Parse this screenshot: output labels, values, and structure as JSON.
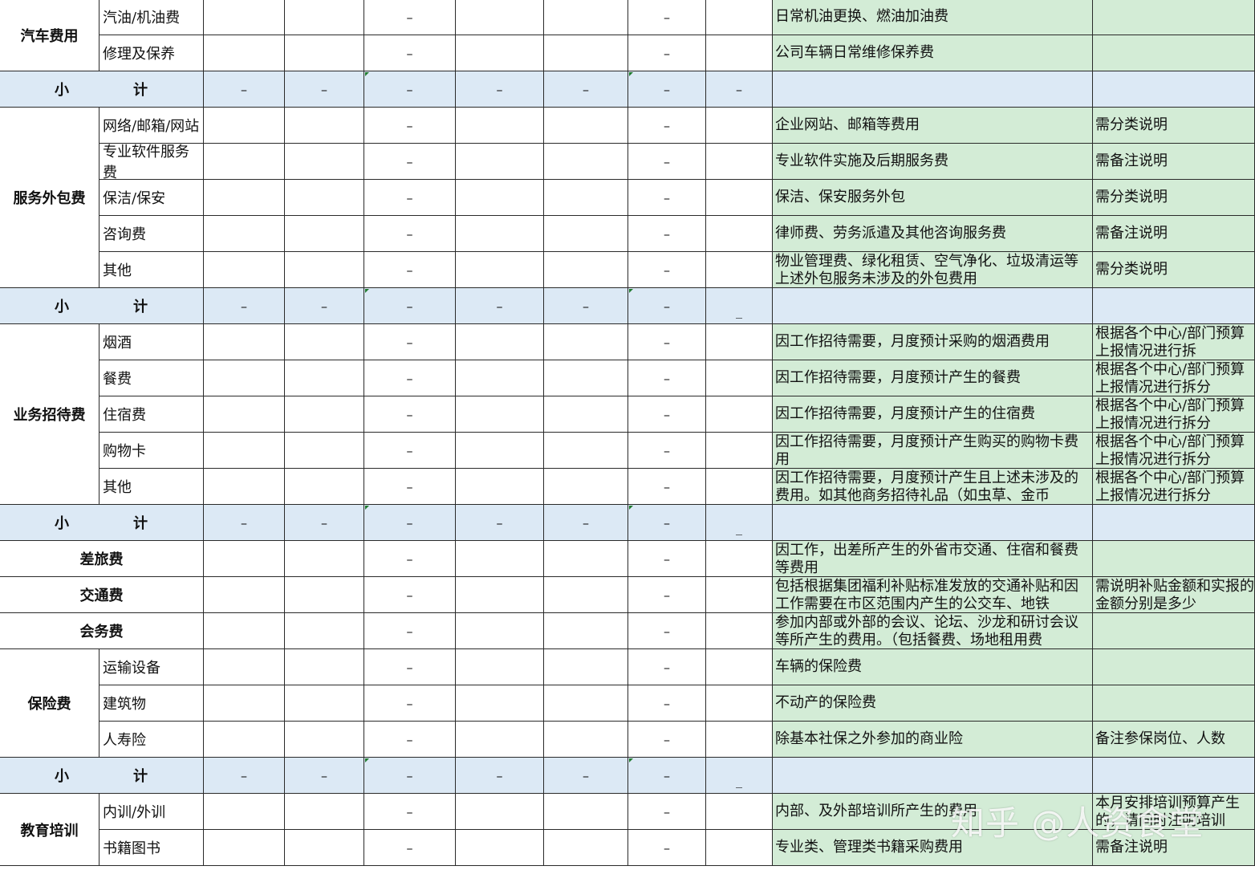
{
  "dash": "–",
  "underscore": "_",
  "subtotal_label": [
    "小",
    "计"
  ],
  "sections": [
    {
      "category": "汽车费用",
      "items": [
        {
          "name": "汽油/机油费",
          "desc": "日常机油更换、燃油加油费",
          "note": ""
        },
        {
          "name": "修理及保养",
          "desc": "公司车辆日常维修保养费",
          "note": ""
        }
      ],
      "subtotal_last": "–"
    },
    {
      "category": "服务外包费",
      "items": [
        {
          "name": "网络/邮箱/网站",
          "desc": "企业网站、邮箱等费用",
          "note": "需分类说明"
        },
        {
          "name": "专业软件服务费",
          "desc": "专业软件实施及后期服务费",
          "note": "需备注说明"
        },
        {
          "name": "保洁/保安",
          "desc": "保洁、保安服务外包",
          "note": "需分类说明"
        },
        {
          "name": "咨询费",
          "desc": "律师费、劳务派遣及其他咨询服务费",
          "note": "需备注说明"
        },
        {
          "name": "其他",
          "desc": "物业管理费、绿化租赁、空气净化、垃圾清运等上述外包服务未涉及的外包费用",
          "note": "需分类说明"
        }
      ],
      "subtotal_last": "_"
    },
    {
      "category": "业务招待费",
      "items": [
        {
          "name": "烟酒",
          "desc": "因工作招待需要，月度预计采购的烟酒费用",
          "note": "根据各个中心/部门预算上报情况进行拆"
        },
        {
          "name": "餐费",
          "desc": "因工作招待需要，月度预计产生的餐费",
          "note": "根据各个中心/部门预算上报情况进行拆分"
        },
        {
          "name": "住宿费",
          "desc": "因工作招待需要，月度预计产生的住宿费",
          "note": "根据各个中心/部门预算上报情况进行拆分"
        },
        {
          "name": "购物卡",
          "desc": "因工作招待需要，月度预计产生购买的购物卡费用",
          "note": "根据各个中心/部门预算上报情况进行拆分"
        },
        {
          "name": "其他",
          "desc": "因工作招待需要，月度预计产生且上述未涉及的费用。如其他商务招待礼品（如虫草、金币",
          "note": "根据各个中心/部门预算上报情况进行拆分"
        }
      ],
      "subtotal_last": "_"
    },
    {
      "singles": [
        {
          "category": "差旅费",
          "desc": "因工作，出差所产生的外省市交通、住宿和餐费等费用",
          "note": ""
        },
        {
          "category": "交通费",
          "desc": "包括根据集团福利补贴标准发放的交通补贴和因工作需要在市区范围内产生的公交车、地铁",
          "note": "需说明补贴金额和实报的金额分别是多少"
        },
        {
          "category": "会务费",
          "desc": "参加内部或外部的会议、论坛、沙龙和研讨会议等所产生的费用。（包括餐费、场地租用费",
          "note": ""
        }
      ]
    },
    {
      "category": "保险费",
      "items": [
        {
          "name": "运输设备",
          "desc": "车辆的保险费",
          "note": ""
        },
        {
          "name": "建筑物",
          "desc": "不动产的保险费",
          "note": ""
        },
        {
          "name": "人寿险",
          "desc": "除基本社保之外参加的商业险",
          "note": "备注参保岗位、人数"
        }
      ],
      "subtotal_last": "_"
    },
    {
      "category": "教育培训",
      "items": [
        {
          "name": "内训/外训",
          "desc": "内部、及外部培训所产生的费用",
          "note": "本月安排培训预算产生的，请同时注明培训"
        },
        {
          "name": "书籍图书",
          "desc": "专业类、管理类书籍采购费用",
          "note": "需备注说明"
        }
      ]
    }
  ],
  "watermark": "知乎 @人资食堂"
}
